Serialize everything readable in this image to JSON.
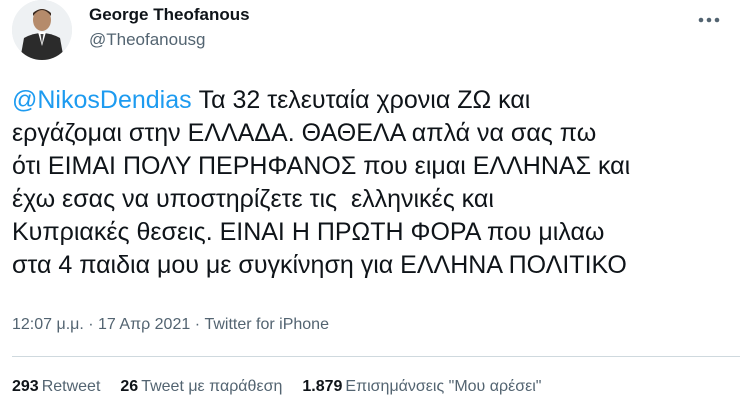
{
  "author": {
    "display_name": "George Theofanous",
    "handle": "@Theofanousg"
  },
  "tweet": {
    "mention": "@NikosDendias",
    "lines": [
      " Τα 32 τελευταία χρονια ΖΩ και",
      "εργάζομαι στην ΕΛΛΑΔΑ. ΘΑΘΕΛΑ απλά να σας πω",
      "ότι ΕΙΜΑΙ ΠΟΛΥ ΠΕΡΗΦΑΝΟΣ που ειμαι ΕΛΛΗΝΑΣ και",
      "έχω εσας να υποστηρίζετε τις  ελληνικές και",
      "Κυπριακές θεσεις. ΕΙΝΑΙ Η ΠΡΩΤΗ ΦΟΡΑ που μιλαω",
      "στα 4 παιδια μου με συγκίνηση για ΕΛΛΗΝΑ ΠΟΛΙΤΙΚΟ"
    ]
  },
  "meta": {
    "time": "12:07 μ.μ.",
    "separator": " · ",
    "date": "17 Απρ 2021",
    "source": "Twitter for iPhone"
  },
  "stats": {
    "retweets_count": "293",
    "retweets_label": "Retweet",
    "quotes_count": "26",
    "quotes_label": "Tweet με παράθεση",
    "likes_count": "1.879",
    "likes_label": "Επισημάνσεις \"Μου αρέσει\""
  },
  "colors": {
    "mention": "#1d9bf0",
    "text": "#0f1419",
    "secondary": "#536471",
    "divider": "#cfd9de"
  },
  "icons": {
    "more": "more-horizontal-icon",
    "avatar": "profile-avatar"
  }
}
